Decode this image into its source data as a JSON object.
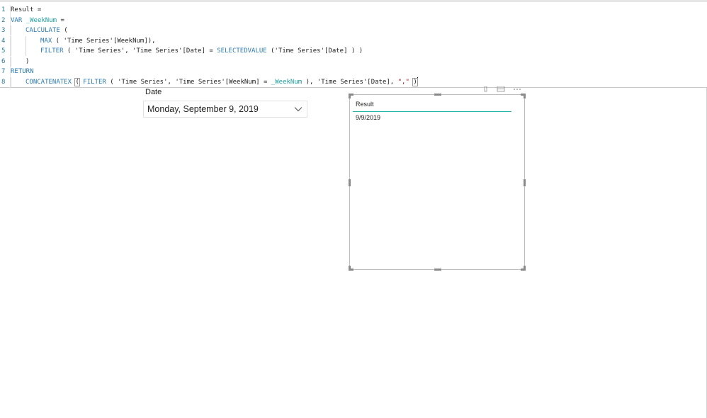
{
  "editor": {
    "lines": [
      {
        "num": "1",
        "segments": [
          {
            "t": "Result =",
            "c": "plain"
          }
        ]
      },
      {
        "num": "2",
        "segments": [
          {
            "t": "VAR",
            "c": "kw"
          },
          {
            "t": " ",
            "c": "plain"
          },
          {
            "t": "_WeekNum",
            "c": "var"
          },
          {
            "t": " =",
            "c": "plain"
          }
        ]
      },
      {
        "num": "3",
        "indent": 1,
        "segments": [
          {
            "t": "CALCULATE",
            "c": "kw"
          },
          {
            "t": " (",
            "c": "plain"
          }
        ]
      },
      {
        "num": "4",
        "indent": 2,
        "segments": [
          {
            "t": "MAX",
            "c": "kw"
          },
          {
            "t": " ( ",
            "c": "plain"
          },
          {
            "t": "'Time Series'[WeekNum]",
            "c": "plain"
          },
          {
            "t": "),",
            "c": "plain"
          }
        ]
      },
      {
        "num": "5",
        "indent": 2,
        "segments": [
          {
            "t": "FILTER",
            "c": "kw"
          },
          {
            "t": " ( 'Time Series', 'Time Series'[Date] = ",
            "c": "plain"
          },
          {
            "t": "SELECTEDVALUE",
            "c": "kw"
          },
          {
            "t": " ('Time Series'[Date] ) )",
            "c": "plain"
          }
        ]
      },
      {
        "num": "6",
        "indent": 1,
        "segments": [
          {
            "t": ")",
            "c": "plain"
          }
        ]
      },
      {
        "num": "7",
        "segments": [
          {
            "t": "RETURN",
            "c": "kw"
          }
        ]
      },
      {
        "num": "8",
        "indent": 1,
        "segments": [
          {
            "t": "CONCATENATEX",
            "c": "kw"
          },
          {
            "t": " ",
            "c": "plain"
          },
          {
            "t": "(",
            "c": "bracket"
          },
          {
            "t": " ",
            "c": "plain"
          },
          {
            "t": "FILTER",
            "c": "kw"
          },
          {
            "t": " ( 'Time Series', 'Time Series'[WeekNum] = ",
            "c": "plain"
          },
          {
            "t": "_WeekNum",
            "c": "var"
          },
          {
            "t": " ), 'Time Series'[Date], ",
            "c": "plain"
          },
          {
            "t": "\",\"",
            "c": "str"
          },
          {
            "t": " ",
            "c": "plain"
          },
          {
            "t": ")",
            "c": "bracket"
          }
        ],
        "cursor": true
      }
    ]
  },
  "slicer": {
    "label": "Date",
    "selected_value": "Monday, September 9, 2019"
  },
  "table_visual": {
    "column_header": "Result",
    "rows": [
      "9/9/2019"
    ],
    "accent_color": "#23b3a3"
  }
}
